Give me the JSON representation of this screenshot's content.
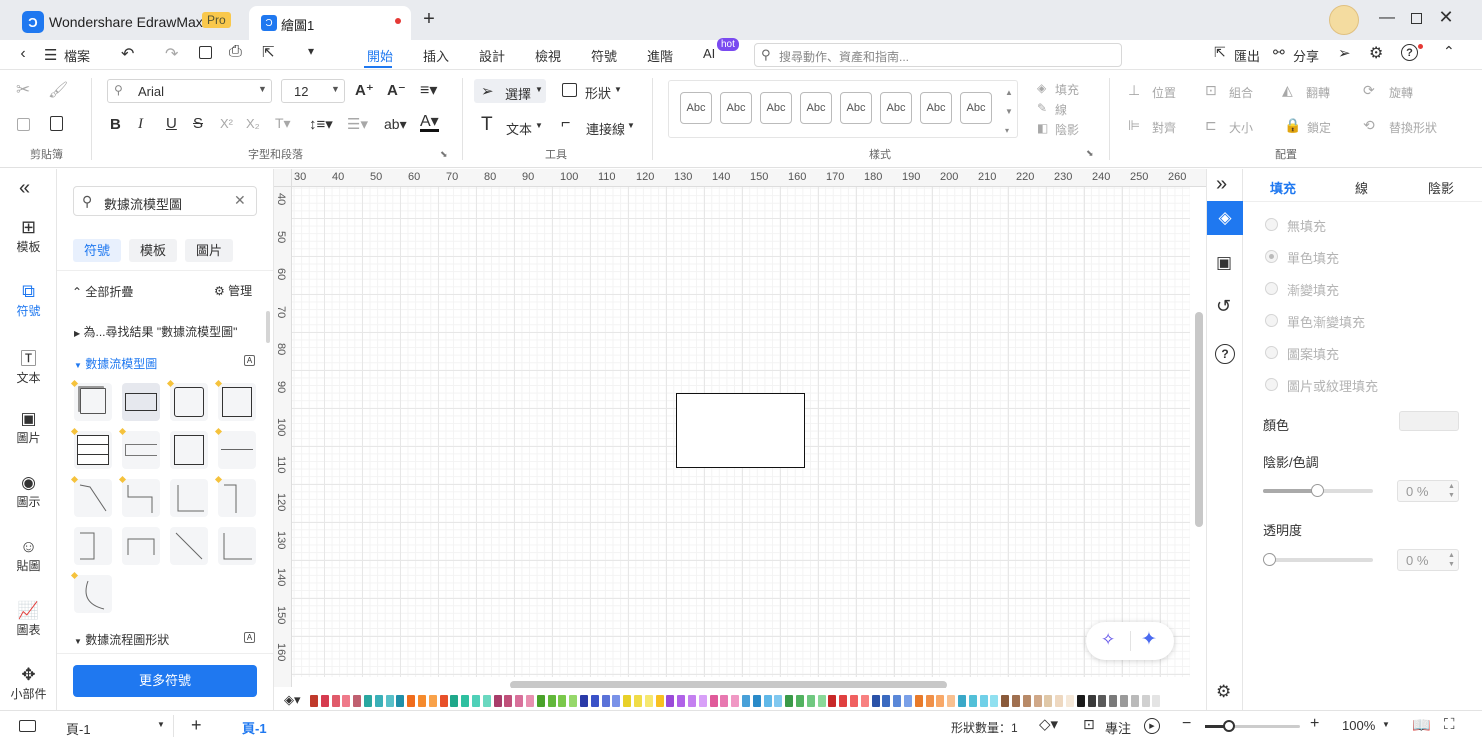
{
  "app": {
    "title": "Wondershare EdrawMax",
    "badge": "Pro",
    "doc_tab": "繪圖1"
  },
  "menu": {
    "file": "檔案",
    "tabs": [
      "開始",
      "插入",
      "設計",
      "檢視",
      "符號",
      "進階",
      "AI"
    ],
    "ai_badge": "hot",
    "search_placeholder": "搜尋動作、資產和指南...",
    "export": "匯出",
    "share": "分享"
  },
  "ribbon": {
    "font_name": "Arial",
    "font_size": "12",
    "select": "選擇",
    "shape": "形狀",
    "text": "文本",
    "connector": "連接線",
    "style_samples": [
      "Abc",
      "Abc",
      "Abc",
      "Abc",
      "Abc",
      "Abc",
      "Abc",
      "Abc"
    ],
    "fill": "填充",
    "line": "線",
    "shadow": "陰影",
    "position": "位置",
    "group": "組合",
    "flip": "翻轉",
    "rotate": "旋轉",
    "align": "對齊",
    "size": "大小",
    "lock": "鎖定",
    "replace": "替換形狀",
    "groups": {
      "clipboard": "剪貼簿",
      "font": "字型和段落",
      "tools": "工具",
      "style": "樣式",
      "arrange": "配置"
    }
  },
  "leftnav": [
    "模板",
    "符號",
    "文本",
    "圖片",
    "圖示",
    "貼圖",
    "圖表",
    "小部件"
  ],
  "library": {
    "search_value": "數據流模型圖",
    "tabs": [
      "符號",
      "模板",
      "圖片"
    ],
    "collapse_all": "全部折疊",
    "manage": "管理",
    "search_result": "為...尋找結果 \"數據流模型圖\"",
    "section1": "數據流模型圖",
    "section2": "數據流程圖形狀",
    "more": "更多符號"
  },
  "ruler": {
    "h": [
      "30",
      "40",
      "50",
      "60",
      "70",
      "80",
      "90",
      "100",
      "110",
      "120",
      "130",
      "140",
      "150",
      "160",
      "170",
      "180",
      "190",
      "200",
      "210",
      "220",
      "230",
      "240",
      "250",
      "260"
    ],
    "v": [
      "40",
      "50",
      "60",
      "70",
      "80",
      "90",
      "100",
      "110",
      "120",
      "130",
      "140",
      "150",
      "160"
    ]
  },
  "props": {
    "tabs": [
      "填充",
      "線",
      "陰影"
    ],
    "options": [
      "無填充",
      "單色填充",
      "漸變填充",
      "單色漸變填充",
      "圖案填充",
      "圖片或紋理填充"
    ],
    "color_label": "顏色",
    "shade_label": "陰影/色調",
    "shade_value": "0 %",
    "transparency_label": "透明度",
    "transparency_value": "0 %"
  },
  "status": {
    "page_select": "頁-1",
    "page_tab": "頁-1",
    "shape_count": "形狀數量：1",
    "focus": "專注",
    "zoom": "100%"
  },
  "palette": [
    "#c0392b",
    "#d63b4f",
    "#e05a6a",
    "#ef7a8a",
    "#c06070",
    "#2aa7a0",
    "#3ab0b8",
    "#58c0c8",
    "#1f8fa8",
    "#f06c1c",
    "#f58a2c",
    "#f9a24a",
    "#e8502a",
    "#1fa88a",
    "#2ec0a0",
    "#4fd0b8",
    "#6ad8c0",
    "#a83d6a",
    "#c0507a",
    "#d8709a",
    "#e890b0",
    "#4aa22a",
    "#62b83a",
    "#7ac84a",
    "#96d86a",
    "#2a3aa8",
    "#3a52c8",
    "#5a72d8",
    "#7a92e8",
    "#e8d028",
    "#f0dc48",
    "#f6e870",
    "#f8c020",
    "#9a4ad8",
    "#b062e8",
    "#c480f0",
    "#d8a0f8",
    "#e05a9a",
    "#e878b0",
    "#f098c4",
    "#48a0d8",
    "#2a8ac8",
    "#60b8e8",
    "#80c8f0",
    "#3a9a48",
    "#52b260",
    "#70c880",
    "#8ad898",
    "#c82828",
    "#e04040",
    "#f06060",
    "#f88080",
    "#2a52a8",
    "#3a6ac0",
    "#5a88d8",
    "#7aa0e8",
    "#e87a2a",
    "#f09048",
    "#f8a868",
    "#f8c090",
    "#3aa8c8",
    "#52c0d8",
    "#70d0e8",
    "#90e0f0",
    "#8a5a3a",
    "#a07050",
    "#b88a68",
    "#d0a888",
    "#e0c8a8",
    "#eed8c0",
    "#f5e8d8",
    "#1a1a1a",
    "#3a3a3a",
    "#5a5a5a",
    "#7a7a7a",
    "#9a9a9a",
    "#bababa",
    "#d0d0d0",
    "#e4e4e4"
  ]
}
